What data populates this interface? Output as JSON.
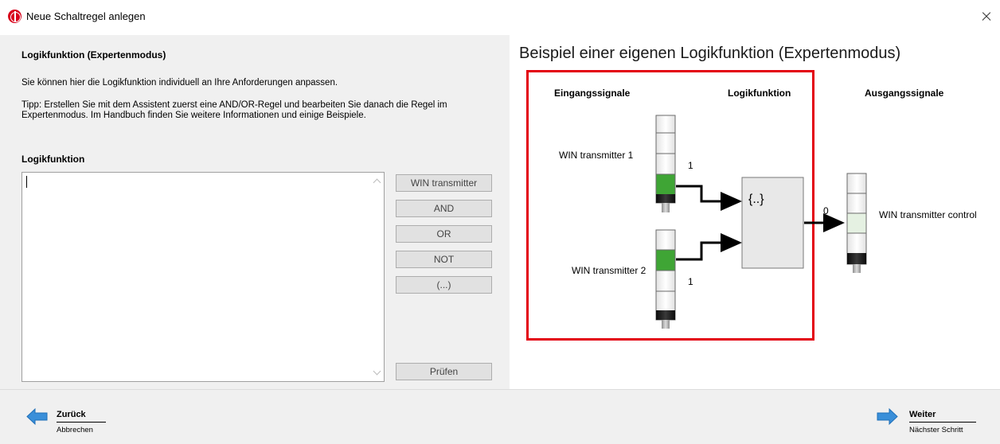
{
  "window": {
    "title": "Neue Schaltregel anlegen"
  },
  "left": {
    "section_title": "Logikfunktion (Expertenmodus)",
    "intro": "Sie können hier die Logikfunktion individuell an Ihre Anforderungen anpassen.",
    "tip": "Tipp: Erstellen Sie mit dem Assistent zuerst eine AND/OR-Regel und bearbeiten Sie danach die Regel im Expertenmodus. Im Handbuch finden Sie weitere Informationen und einige Beispiele.",
    "logic_label": "Logikfunktion",
    "editor_value": "",
    "buttons": {
      "win_transmitter": "WIN transmitter",
      "and": "AND",
      "or": "OR",
      "not": "NOT",
      "parens": "(...)",
      "check": "Prüfen"
    }
  },
  "example": {
    "title": "Beispiel einer eigenen Logikfunktion (Expertenmodus)",
    "headings": {
      "inputs": "Eingangssignale",
      "logic": "Logikfunktion",
      "outputs": "Ausgangssignale"
    },
    "input1_label": "WIN transmitter 1",
    "input1_value": "1",
    "input2_label": "WIN transmitter 2",
    "input2_value": "1",
    "logic_symbol": "{..}",
    "output_value": "0",
    "output_label": "WIN transmitter control",
    "highlight_color": "#e3000f",
    "active_green": "#3fa535",
    "inactive_green": "#e5f1e2"
  },
  "nav": {
    "back_label": "Zurück",
    "back_sub": "Abbrechen",
    "next_label": "Weiter",
    "next_sub": "Nächster Schritt",
    "arrow_color": "#3a8fd9"
  }
}
